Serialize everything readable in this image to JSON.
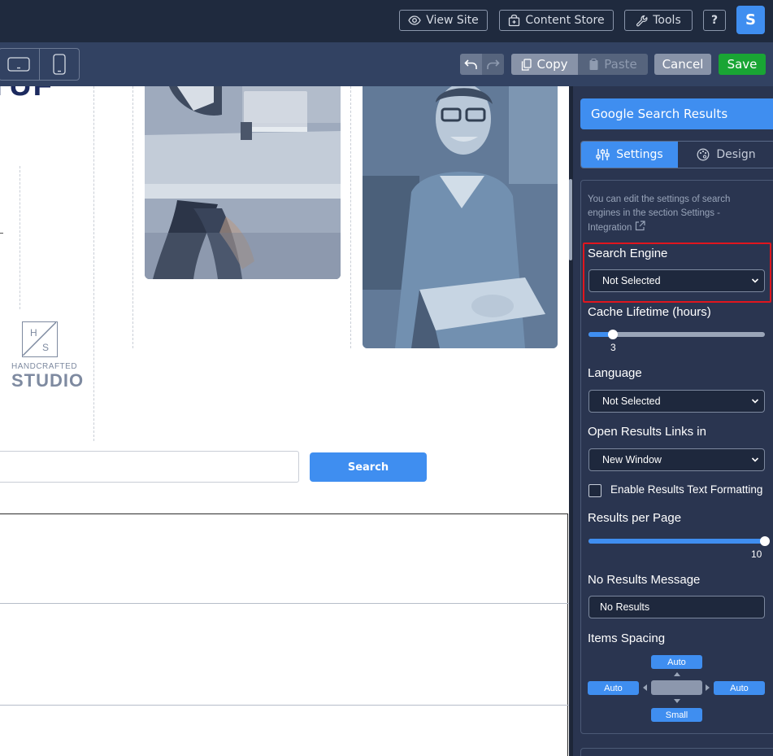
{
  "topbar": {
    "view_site": "View Site",
    "content_store": "Content Store",
    "tools": "Tools",
    "help": "?",
    "avatar_initial": "S"
  },
  "toolbar": {
    "copy": "Copy",
    "paste": "Paste",
    "cancel": "Cancel",
    "save": "Save"
  },
  "canvas": {
    "heading_fragment": "TUF",
    "logo_line1": "HANDCRAFTED",
    "logo_line2": "STUDIO",
    "logo_letters": "H S",
    "search_button": "Search"
  },
  "panel": {
    "title": "Google Search Results",
    "tabs": [
      {
        "label": "Settings",
        "active": true
      },
      {
        "label": "Design",
        "active": false
      }
    ],
    "hint": "You can edit the settings of search engines in the section Settings - Integration",
    "search_engine": {
      "label": "Search Engine",
      "value": "Not Selected"
    },
    "cache_lifetime": {
      "label": "Cache Lifetime (hours)",
      "value": "3",
      "fraction": 0.14
    },
    "language": {
      "label": "Language",
      "value": "Not Selected"
    },
    "open_links": {
      "label": "Open Results Links in",
      "value": "New Window"
    },
    "text_formatting": {
      "label": "Enable Results Text Formatting",
      "checked": false
    },
    "results_per_page": {
      "label": "Results per Page",
      "value": "10",
      "fraction": 1.0
    },
    "no_results_message": {
      "label": "No Results Message",
      "value": "No Results"
    },
    "items_spacing": {
      "label": "Items Spacing",
      "top": "Auto",
      "left": "Auto",
      "right": "Auto",
      "bottom": "Small"
    }
  },
  "colors": {
    "accent": "#3f8ef0",
    "save_green": "#19a534",
    "highlight_red": "#e0161e",
    "panel_bg": "#2a3550"
  }
}
